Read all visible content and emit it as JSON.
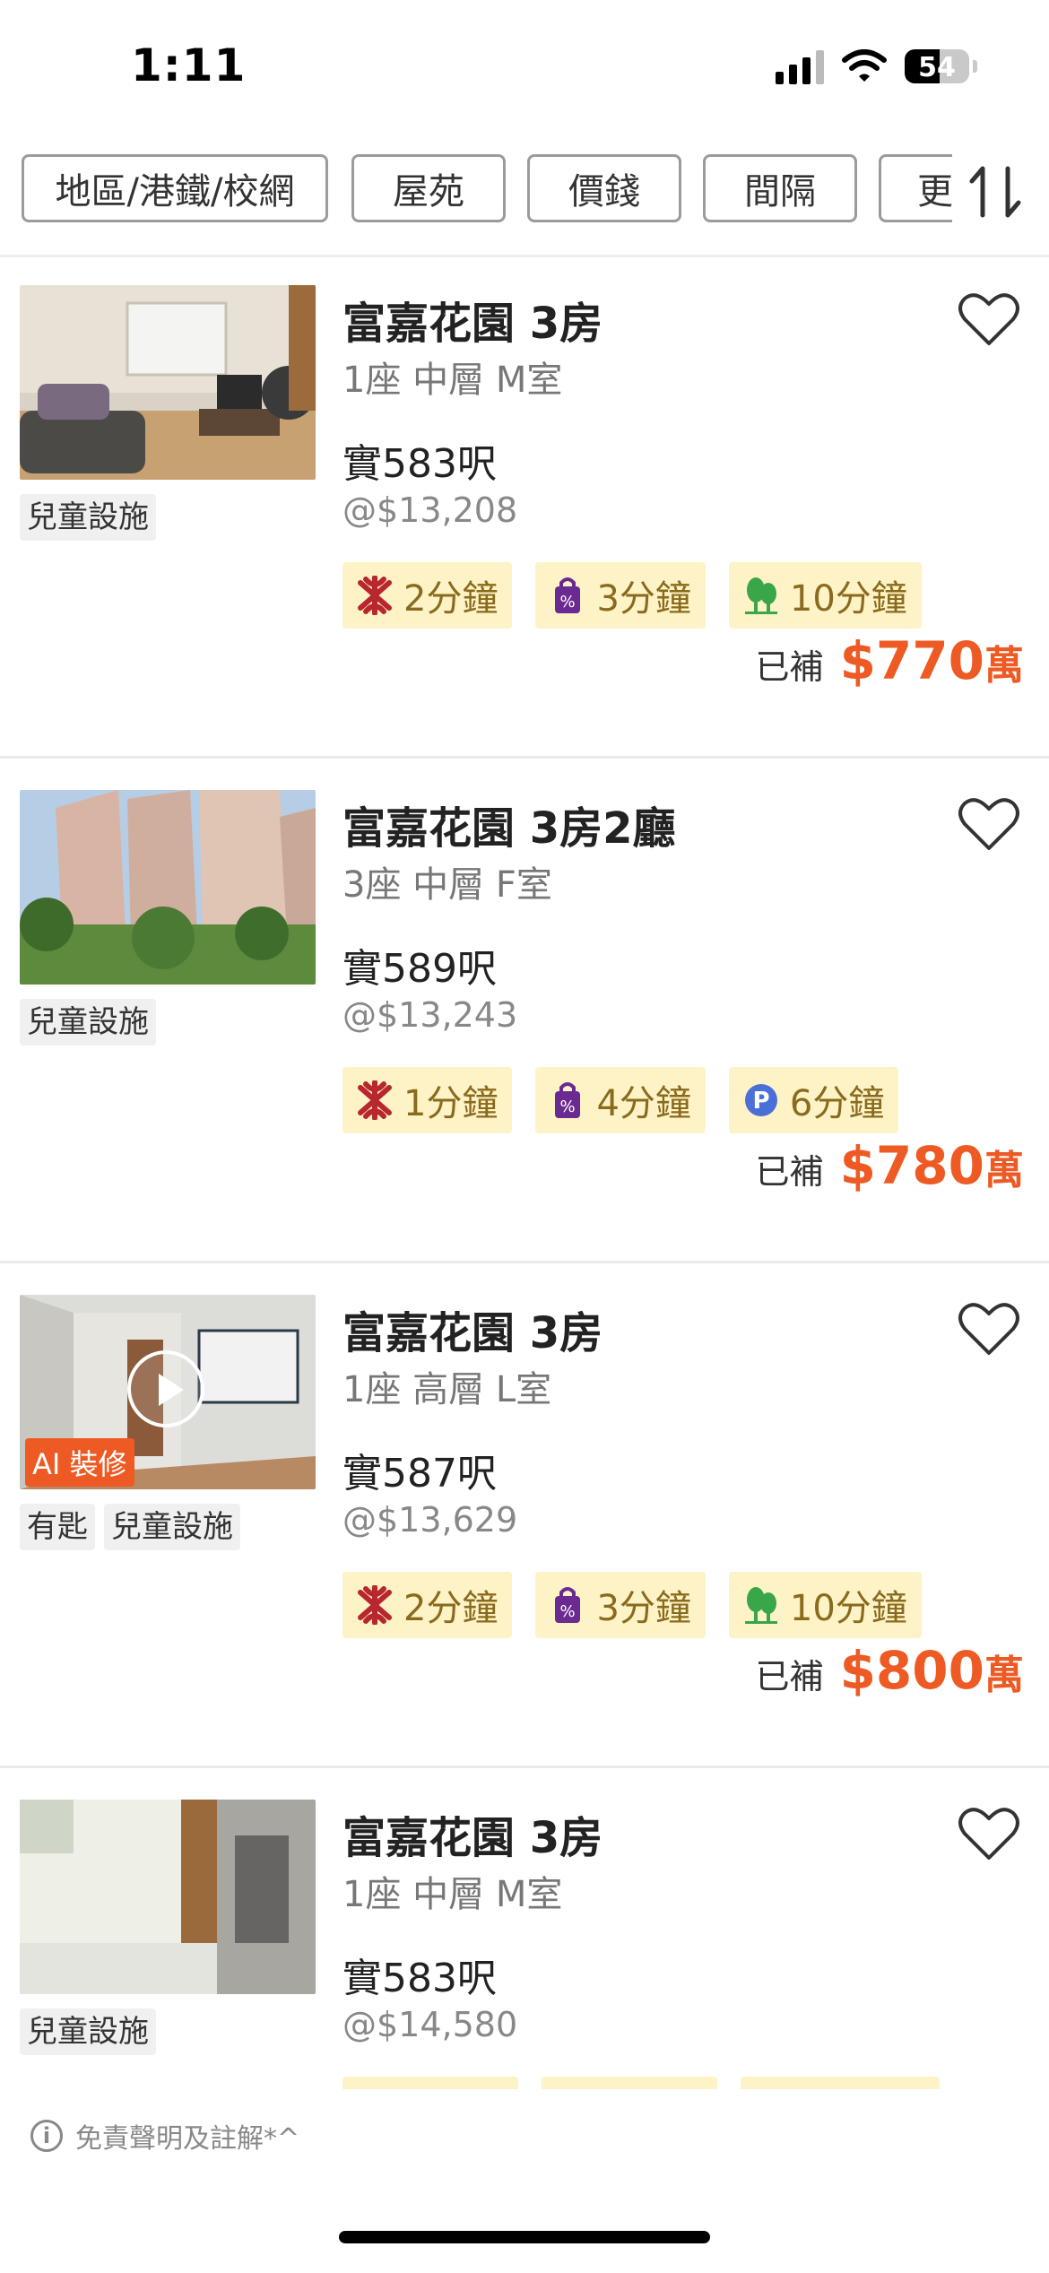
{
  "status_bar": {
    "time": "1:11",
    "battery": "54",
    "battery_level": 0.54
  },
  "filters": {
    "chips": [
      "地區/港鐵/校網",
      "屋苑",
      "價錢",
      "間隔",
      "更"
    ]
  },
  "colors": {
    "accent": "#ee5a24",
    "badge_bg": "#fdf3c6",
    "badge_text": "#8a6a1c"
  },
  "listings": [
    {
      "title": "富嘉花園 3房",
      "subtitle": "1座 中層 M室",
      "area": "實583呎",
      "unit_price": "@$13,208",
      "tags": [
        "兒童設施"
      ],
      "badges": [
        {
          "icon": "mtr-icon",
          "text": "2分鐘"
        },
        {
          "icon": "shopping-bag-icon",
          "text": "3分鐘"
        },
        {
          "icon": "park-icon",
          "text": "10分鐘"
        }
      ],
      "price_label": "已補",
      "price": "$770",
      "price_unit": "萬"
    },
    {
      "title": "富嘉花園 3房2廳",
      "subtitle": "3座 中層 F室",
      "area": "實589呎",
      "unit_price": "@$13,243",
      "tags": [
        "兒童設施"
      ],
      "badges": [
        {
          "icon": "mtr-icon",
          "text": "1分鐘"
        },
        {
          "icon": "shopping-bag-icon",
          "text": "4分鐘"
        },
        {
          "icon": "parking-icon",
          "text": "6分鐘"
        }
      ],
      "price_label": "已補",
      "price": "$780",
      "price_unit": "萬"
    },
    {
      "title": "富嘉花園 3房",
      "subtitle": "1座 高層 L室",
      "area": "實587呎",
      "unit_price": "@$13,629",
      "tags": [
        "有匙",
        "兒童設施"
      ],
      "ai_label": "AI 裝修",
      "badges": [
        {
          "icon": "mtr-icon",
          "text": "2分鐘"
        },
        {
          "icon": "shopping-bag-icon",
          "text": "3分鐘"
        },
        {
          "icon": "park-icon",
          "text": "10分鐘"
        }
      ],
      "price_label": "已補",
      "price": "$800",
      "price_unit": "萬"
    },
    {
      "title": "富嘉花園 3房",
      "subtitle": "1座 中層 M室",
      "area": "實583呎",
      "unit_price": "@$14,580",
      "tags": [
        "兒童設施"
      ],
      "badges": []
    }
  ],
  "footer": {
    "disclaimer": "免責聲明及註解*^"
  }
}
